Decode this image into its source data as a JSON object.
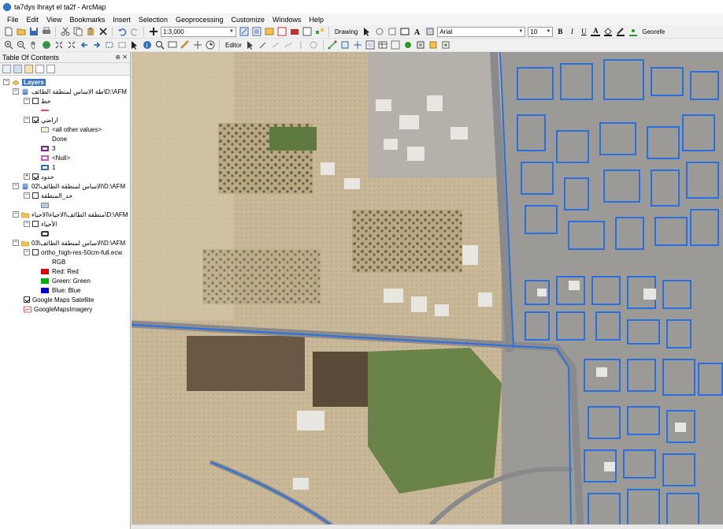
{
  "window": {
    "title": "ta7dys lhrayt el ta2f - ArcMap"
  },
  "menu": [
    "File",
    "Edit",
    "View",
    "Bookmarks",
    "Insert",
    "Selection",
    "Geoprocessing",
    "Customize",
    "Windows",
    "Help"
  ],
  "toolbar": {
    "scale": "1:3,000",
    "drawing_label": "Drawing",
    "font_name": "Arial",
    "font_size": "10",
    "bold": "B",
    "italic": "I",
    "underline": "U",
    "font_color_letter": "A",
    "georef_label": "Georefe",
    "editor_label": "Editor"
  },
  "toc": {
    "title": "Table Of Contents",
    "root": "Layers",
    "groups": [
      {
        "path": "طة الاساس لمنطقة الطائف\\D:\\AFM",
        "layers": [
          {
            "name": "خط",
            "checked": false,
            "symbols": [
              {
                "label": "",
                "color": "#e05050",
                "kind": "line"
              }
            ]
          },
          {
            "name": "اراضي",
            "checked": true,
            "symbols": [
              {
                "label": "<all other values>",
                "color": "#f2f2c8",
                "kind": "fill"
              },
              {
                "label": "Done",
                "color": "",
                "kind": "none"
              },
              {
                "label": "3",
                "color": "#7a2a7a",
                "kind": "box"
              },
              {
                "label": "<Null>",
                "color": "#c060c0",
                "kind": "box"
              },
              {
                "label": "1",
                "color": "#3a6fb0",
                "kind": "box"
              }
            ]
          },
          {
            "name": "حدود",
            "checked": true,
            "symbols": []
          }
        ]
      },
      {
        "path": "الاساس لمنطقة الطائف\\02\\D:\\AFM",
        "layers": [
          {
            "name": "حد_المنطقة",
            "checked": false,
            "symbols": [
              {
                "label": "",
                "color": "#b8c8e8",
                "kind": "fill"
              }
            ]
          }
        ]
      },
      {
        "path": "منطقة الطائف\\الاحياء\\الاحياء\\D:\\AFM",
        "layers": [
          {
            "name": "الأحياء",
            "checked": false,
            "symbols": [
              {
                "label": "",
                "color": "#333333",
                "kind": "box"
              }
            ]
          }
        ]
      },
      {
        "path": "الاساس لمنطقة الطائف\\03\\D:\\AFM",
        "layers": [
          {
            "name": "ortho_high-res-50cm-full.ecw",
            "checked": false,
            "symbols": [
              {
                "label": "RGB",
                "color": "",
                "kind": "none"
              },
              {
                "label": "Red:   Red",
                "color": "#e00000",
                "kind": "solid"
              },
              {
                "label": "Green: Green",
                "color": "#00b000",
                "kind": "solid"
              },
              {
                "label": "Blue:   Blue",
                "color": "#0000d0",
                "kind": "solid"
              }
            ]
          }
        ]
      }
    ],
    "basemaps": [
      {
        "name": "Google Maps Satellite",
        "checked": true
      },
      {
        "name": "GoogleMapsImagery",
        "checked": null
      }
    ]
  },
  "map": {
    "parcel_outline_color": "#2a6fe0",
    "ground_color": "#c9b998",
    "road_color": "#8a8a8c"
  }
}
